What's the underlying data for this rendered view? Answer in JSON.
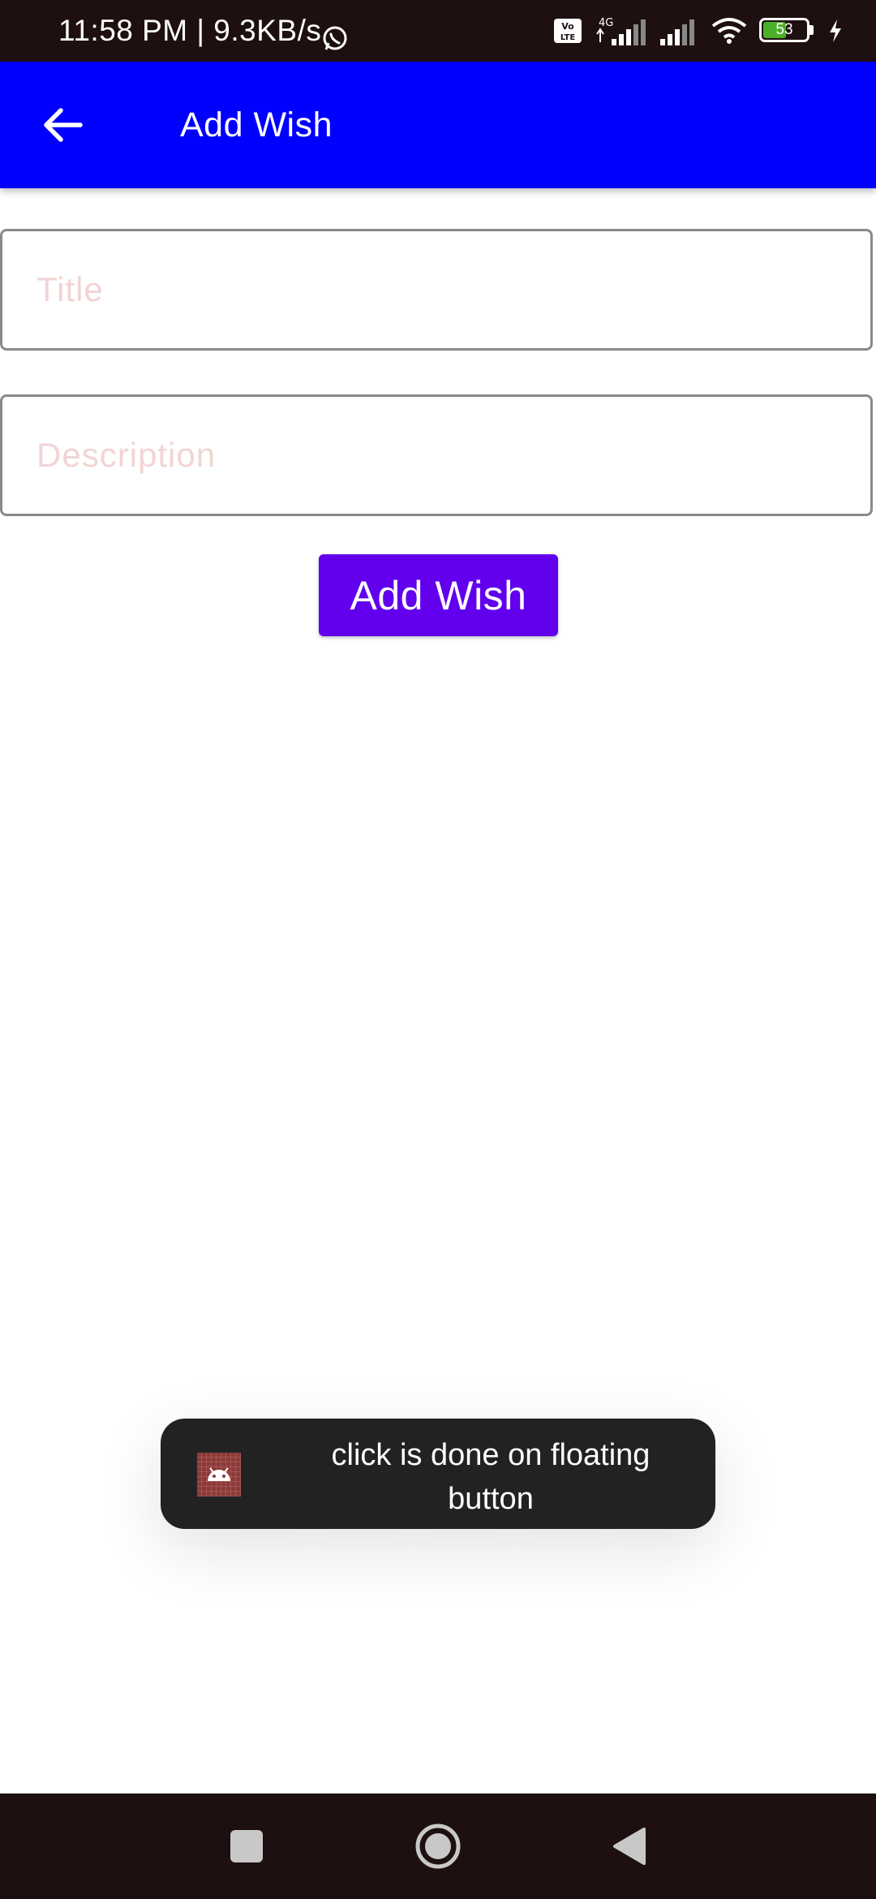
{
  "status_bar": {
    "time": "11:58 PM | 9.3KB/s",
    "battery_level": "53",
    "icons": [
      "whatsapp-icon",
      "volte-icon",
      "signal-4g-icon",
      "signal-icon",
      "wifi-icon",
      "battery-icon",
      "charging-icon"
    ]
  },
  "app_bar": {
    "title": "Add Wish",
    "back_icon": "arrow-back-icon"
  },
  "form": {
    "title_placeholder": "Title",
    "title_value": "",
    "description_placeholder": "Description",
    "description_value": "",
    "submit_label": "Add Wish"
  },
  "toast": {
    "message": "click is done on floating button",
    "icon": "android-app-icon"
  },
  "nav_bar": {
    "buttons": [
      "recents-icon",
      "home-icon",
      "back-triangle-icon"
    ]
  },
  "colors": {
    "app_bar": "#0000ff",
    "button": "#6200ee",
    "status_bar": "#1e1010",
    "placeholder": "#f2d4d4"
  }
}
